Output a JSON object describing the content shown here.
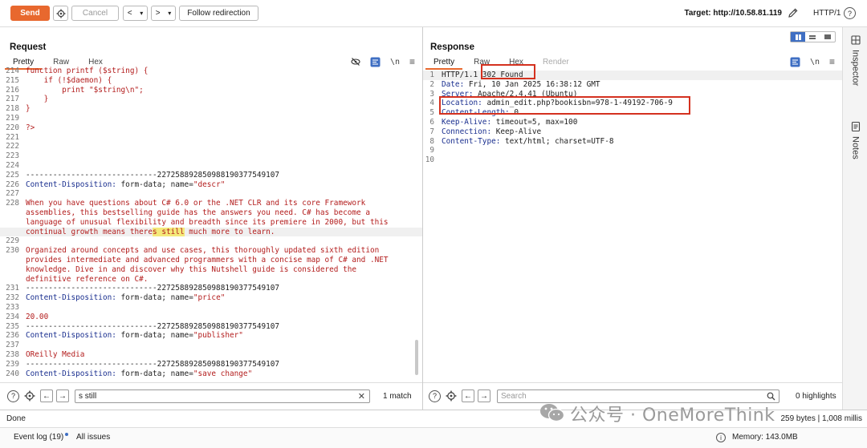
{
  "topbar": {
    "send_label": "Send",
    "cancel_label": "Cancel",
    "back_label": "<",
    "back_dropdown": "▾",
    "forward_label": ">",
    "forward_dropdown": "▾",
    "follow_label": "Follow redirection",
    "target_label": "Target: http://10.58.81.119",
    "http_version": "HTTP/1",
    "help_label": "?"
  },
  "request": {
    "title": "Request",
    "tabs": [
      "Pretty",
      "Raw",
      "Hex"
    ],
    "lines": [
      {
        "n": "214",
        "t": "function printf ($string) {",
        "c": "red"
      },
      {
        "n": "215",
        "t": "    if (!$daemon) {",
        "c": "red"
      },
      {
        "n": "216",
        "t": "        print \"$string\\n\";",
        "c": "red"
      },
      {
        "n": "217",
        "t": "    }",
        "c": "red"
      },
      {
        "n": "218",
        "t": "}",
        "c": "red"
      },
      {
        "n": "219",
        "t": "",
        "c": "red"
      },
      {
        "n": "220",
        "t": "?>",
        "c": "red"
      },
      {
        "n": "221",
        "t": "",
        "c": "red"
      },
      {
        "n": "222",
        "t": "",
        "c": "red"
      },
      {
        "n": "223",
        "t": "",
        "c": "red"
      },
      {
        "n": "224",
        "t": "",
        "c": "red"
      },
      {
        "n": "225",
        "t": "-----------------------------227258892850988190377549107",
        "c": "plain"
      },
      {
        "n": "226",
        "t": "",
        "c": "cd",
        "name": "descr"
      },
      {
        "n": "227",
        "t": "",
        "c": "red"
      },
      {
        "n": "228",
        "t": "When you have questions about C# 6.0 or the .NET CLR and its core Framework",
        "c": "red"
      },
      {
        "n": "",
        "t": "assemblies, this bestselling guide has the answers you need. C# has become a",
        "c": "red"
      },
      {
        "n": "",
        "t": "language of unusual flexibility and breadth since its premiere in 2000, but this",
        "c": "red"
      },
      {
        "n": "",
        "t": "",
        "c": "hlline",
        "pre": "continual growth means there",
        "hl": "s still",
        "post": " much more to learn."
      },
      {
        "n": "229",
        "t": "",
        "c": "red"
      },
      {
        "n": "230",
        "t": "Organized around concepts and use cases, this thoroughly updated sixth edition",
        "c": "red"
      },
      {
        "n": "",
        "t": "provides intermediate and advanced programmers with a concise map of C# and .NET",
        "c": "red"
      },
      {
        "n": "",
        "t": "knowledge. Dive in and discover why this Nutshell guide is considered the",
        "c": "red"
      },
      {
        "n": "",
        "t": "definitive reference on C#.",
        "c": "red"
      },
      {
        "n": "231",
        "t": "-----------------------------227258892850988190377549107",
        "c": "plain"
      },
      {
        "n": "232",
        "t": "",
        "c": "cd",
        "name": "price"
      },
      {
        "n": "233",
        "t": "",
        "c": "red"
      },
      {
        "n": "234",
        "t": "20.00",
        "c": "red"
      },
      {
        "n": "235",
        "t": "-----------------------------227258892850988190377549107",
        "c": "plain"
      },
      {
        "n": "236",
        "t": "",
        "c": "cd",
        "name": "publisher"
      },
      {
        "n": "237",
        "t": "",
        "c": "red"
      },
      {
        "n": "238",
        "t": "OReilly Media",
        "c": "red"
      },
      {
        "n": "239",
        "t": "-----------------------------227258892850988190377549107",
        "c": "plain"
      },
      {
        "n": "240",
        "t": "",
        "c": "cd",
        "name": "save_change"
      },
      {
        "n": "241",
        "t": "",
        "c": "red"
      }
    ],
    "cd_key": "Content-Disposition:",
    "cd_value": " form-data; name=",
    "search_value": "s still",
    "match_label": "1 match"
  },
  "response": {
    "title": "Response",
    "tabs": [
      "Pretty",
      "Raw",
      "Hex",
      "Render"
    ],
    "lines": [
      {
        "n": "1",
        "k": "",
        "v": "HTTP/1.1 302 Found"
      },
      {
        "n": "2",
        "k": "Date:",
        "v": " Fri, 10 Jan 2025 16:38:12 GMT"
      },
      {
        "n": "3",
        "k": "Server:",
        "v": " Apache/2.4.41 (Ubuntu)"
      },
      {
        "n": "4",
        "k": "Location:",
        "v": " admin_edit.php?bookisbn=978-1-49192-706-9"
      },
      {
        "n": "5",
        "k": "Content-Length:",
        "v": " 0"
      },
      {
        "n": "6",
        "k": "Keep-Alive:",
        "v": " timeout=5, max=100"
      },
      {
        "n": "7",
        "k": "Connection:",
        "v": " Keep-Alive"
      },
      {
        "n": "8",
        "k": "Content-Type:",
        "v": " text/html; charset=UTF-8"
      },
      {
        "n": "9",
        "k": "",
        "v": ""
      },
      {
        "n": "10",
        "k": "",
        "v": ""
      }
    ],
    "search_placeholder": "Search",
    "highlights_label": "0 highlights"
  },
  "rail": {
    "inspector_label": "Inspector",
    "notes_label": "Notes"
  },
  "status": {
    "done_label": "Done",
    "bytes_label": "259 bytes | 1,008 millis"
  },
  "bottom": {
    "event_log_label": "Event log (19)",
    "all_issues_label": "All issues",
    "memory_label": "Memory: 143.0MB"
  },
  "watermark": {
    "text": "公众号 · OneMoreThink"
  },
  "colors": {
    "send": "#e8682e",
    "accent_blue": "#3f6fc3",
    "annotation_red": "#d4311f"
  }
}
